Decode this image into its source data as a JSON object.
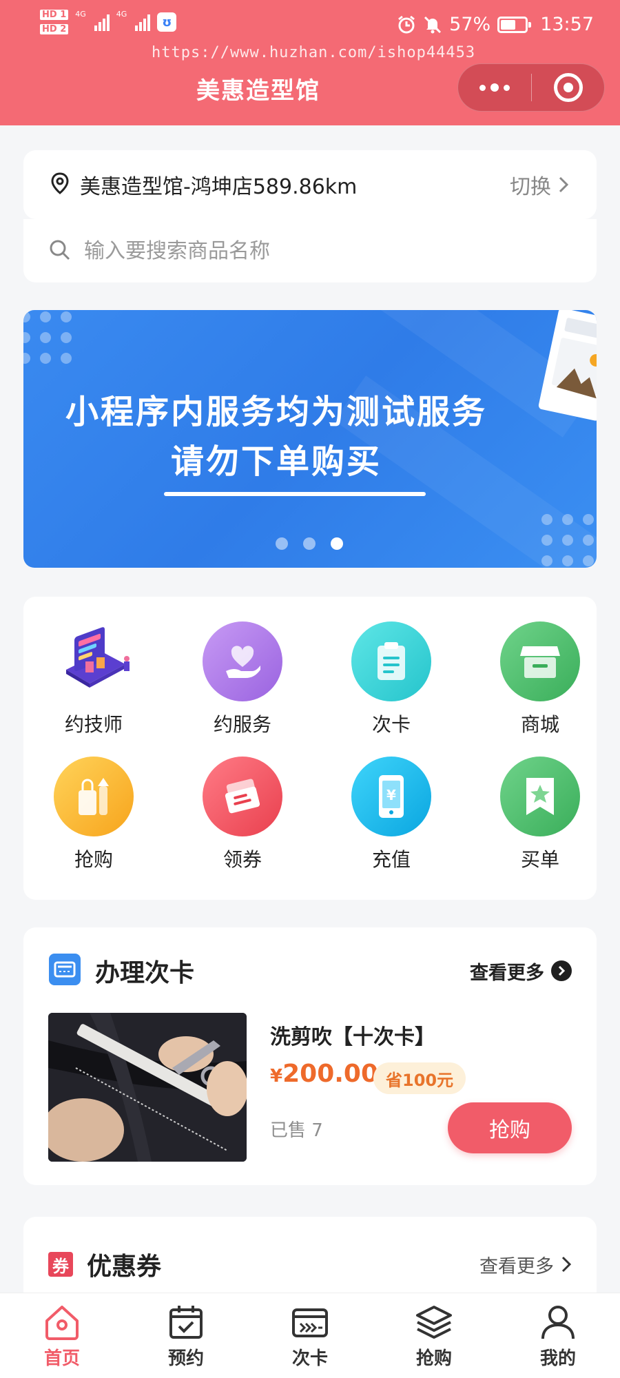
{
  "status_bar": {
    "hd1": "HD 1",
    "hd2": "HD 2",
    "net1": "4G",
    "net2": "4G",
    "app_badge": "ʊ",
    "battery": "57%",
    "time": "13:57"
  },
  "watermark": "https://www.huzhan.com/ishop44453",
  "header": {
    "title": "美惠造型馆",
    "accent": "#f46a74"
  },
  "store": {
    "name": "美惠造型馆-鸿坤店589.86km",
    "switch_label": "切换"
  },
  "search": {
    "placeholder": "输入要搜索商品名称"
  },
  "banner": {
    "line1": "小程序内服务均为测试服务",
    "line2": "请勿下单购买",
    "active_index": 3,
    "total_dots": 3
  },
  "menu": {
    "items": [
      {
        "label": "约技师",
        "icon": "technician-icon"
      },
      {
        "label": "约服务",
        "icon": "heart-hand-icon",
        "color": "#a97be8"
      },
      {
        "label": "次卡",
        "icon": "clipboard-icon",
        "color": "#37d3d6"
      },
      {
        "label": "商城",
        "icon": "store-icon",
        "color": "#4cc26c"
      },
      {
        "label": "抢购",
        "icon": "shopping-bag-icon",
        "color": "#fbb829"
      },
      {
        "label": "领券",
        "icon": "ticket-icon",
        "color": "#f1525f"
      },
      {
        "label": "充值",
        "icon": "phone-yen-icon",
        "color": "#17b8ec"
      },
      {
        "label": "买单",
        "icon": "bookmark-star-icon",
        "color": "#4cc26c"
      }
    ]
  },
  "card_section": {
    "title": "办理次卡",
    "more_label": "查看更多",
    "product": {
      "title": "洗剪吹【十次卡】",
      "currency": "¥",
      "price": "200.00",
      "save": "省100元",
      "sold": "已售 7",
      "buy_label": "抢购"
    }
  },
  "coupon_section": {
    "tag": "券",
    "title": "优惠券",
    "more_label": "查看更多"
  },
  "tabbar": {
    "items": [
      {
        "label": "首页",
        "icon": "home-icon",
        "active": true
      },
      {
        "label": "预约",
        "icon": "calendar-check-icon"
      },
      {
        "label": "次卡",
        "icon": "card-icon"
      },
      {
        "label": "抢购",
        "icon": "layers-icon"
      },
      {
        "label": "我的",
        "icon": "user-icon"
      }
    ],
    "active_color": "#f15c69"
  }
}
